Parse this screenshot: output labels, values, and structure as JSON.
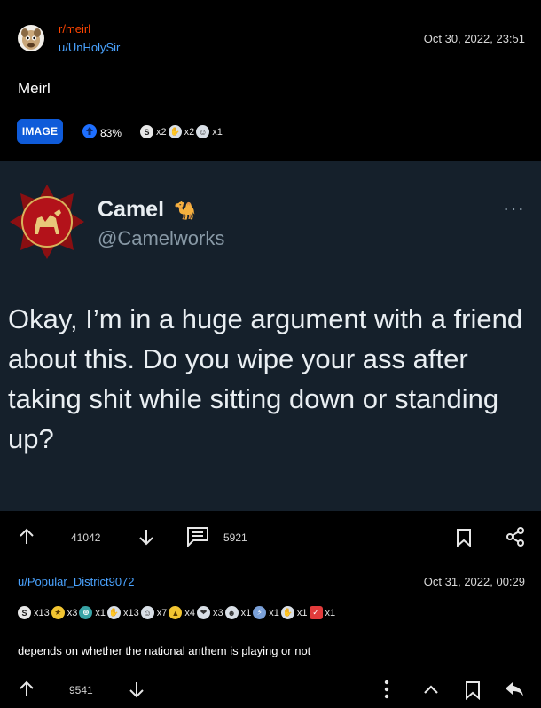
{
  "post": {
    "subreddit": "r/meirl",
    "author": "u/UnHolySir",
    "timestamp": "Oct 30, 2022, 23:51",
    "title": "Meirl",
    "flair": "IMAGE",
    "upvote_ratio": "83%",
    "awards": [
      {
        "icon": "silver-award-icon",
        "count": "x2"
      },
      {
        "icon": "helpful-award-icon",
        "count": "x2"
      },
      {
        "icon": "wholesome-award-icon",
        "count": "x1"
      }
    ],
    "score": "41042",
    "comments": "5921"
  },
  "tweet": {
    "name": "Camel",
    "handle": "@Camelworks",
    "more": "···",
    "text": "Okay, I’m in a huge argument with a friend about this. Do you wipe your ass after taking shit while sitting down or standing up?"
  },
  "comment": {
    "author": "u/Popular_District9072",
    "timestamp": "Oct 31, 2022, 00:29",
    "awards": [
      {
        "icon": "silver-award-icon",
        "count": "x13"
      },
      {
        "icon": "gold-award-icon",
        "count": "x3"
      },
      {
        "icon": "ally-award-icon",
        "count": "x1"
      },
      {
        "icon": "helpful-award-icon",
        "count": "x13"
      },
      {
        "icon": "wholesome-award-icon",
        "count": "x7"
      },
      {
        "icon": "bravo-award-icon",
        "count": "x4"
      },
      {
        "icon": "hugz-award-icon",
        "count": "x3"
      },
      {
        "icon": "laugh-award-icon",
        "count": "x1"
      },
      {
        "icon": "take-my-energy-award-icon",
        "count": "x1"
      },
      {
        "icon": "facepalm-award-icon",
        "count": "x1"
      },
      {
        "icon": "i-voted-award-icon",
        "count": "x1"
      }
    ],
    "text": "depends on whether the national anthem is playing or not",
    "score": "9541"
  }
}
